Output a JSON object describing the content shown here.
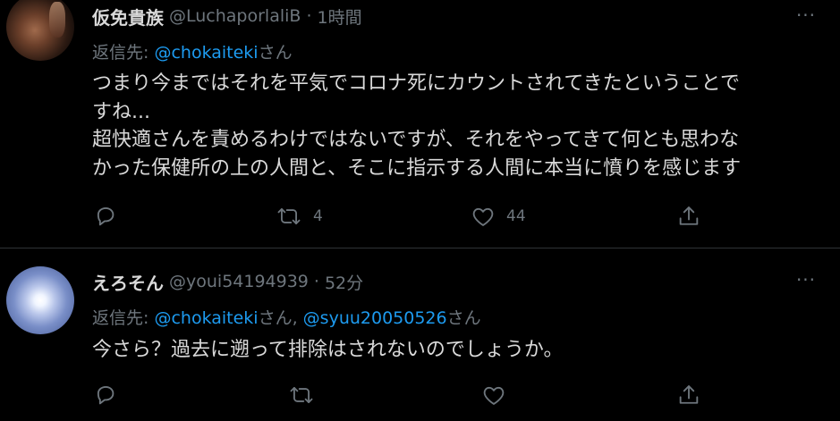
{
  "tweets": [
    {
      "display_name": "仮免貴族",
      "handle": "@LuchaporlaliB",
      "separator": "·",
      "time": "1時間",
      "reply_prefix": "返信先: ",
      "reply_mention_1": "@chokaiteki",
      "reply_suffix_1": "さん",
      "body_lines": [
        "つまり今まではそれを平気でコロナ死にカウントされてきたということで",
        "すね...",
        "超快適さんを責めるわけではないですが、それをやってきて何とも思わな",
        "かった保健所の上の人間と、そこに指示する人間に本当に憤りを感じます"
      ],
      "retweet_count": "4",
      "like_count": "44",
      "more": "···"
    },
    {
      "display_name": "えろそん",
      "handle": "@youi54194939",
      "separator": "·",
      "time": "52分",
      "reply_prefix": "返信先: ",
      "reply_mention_1": "@chokaiteki",
      "reply_suffix_1": "さん, ",
      "reply_mention_2": "@syuu20050526",
      "reply_suffix_2": "さん",
      "body_lines": [
        "今さら？過去に遡って排除はされないのでしょうか。"
      ],
      "retweet_count": "",
      "like_count": "",
      "more": "···"
    }
  ],
  "icons": {
    "reply": "reply-icon",
    "retweet": "retweet-icon",
    "like": "heart-icon",
    "share": "share-icon",
    "more": "more-icon"
  },
  "colors": {
    "background": "#000000",
    "text": "#d9d9d9",
    "muted": "#6e767d",
    "mention": "#1d9bf0",
    "divider": "#2f3336"
  }
}
